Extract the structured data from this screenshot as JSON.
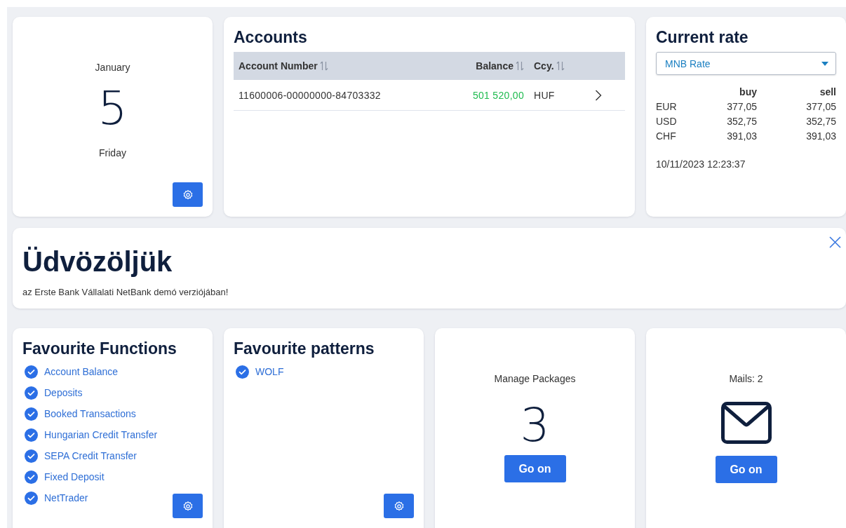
{
  "date_card": {
    "month": "January",
    "day": "5",
    "weekday": "Friday"
  },
  "accounts": {
    "title": "Accounts",
    "columns": [
      {
        "label": "Account Number"
      },
      {
        "label": "Balance"
      },
      {
        "label": "Ccy."
      }
    ],
    "rows": [
      {
        "account_number": "11600006-00000000-84703332",
        "balance": "501 520,00",
        "currency": "HUF"
      }
    ]
  },
  "current_rate": {
    "title": "Current rate",
    "source": {
      "value": "MNB Rate"
    },
    "columns": [
      "buy",
      "sell"
    ],
    "rows": [
      {
        "currency": "EUR",
        "buy": "377,05",
        "sell": "377,05"
      },
      {
        "currency": "USD",
        "buy": "352,75",
        "sell": "352,75"
      },
      {
        "currency": "CHF",
        "buy": "391,03",
        "sell": "391,03"
      }
    ],
    "timestamp": "10/11/2023 12:23:37"
  },
  "welcome": {
    "title": "Üdvözöljük",
    "message": "az Erste Bank Vállalati NetBank demó verziójában!"
  },
  "favourite_functions": {
    "title": "Favourite Functions",
    "items": [
      {
        "label": "Account Balance"
      },
      {
        "label": "Deposits"
      },
      {
        "label": "Booked Transactions"
      },
      {
        "label": "Hungarian Credit Transfer"
      },
      {
        "label": "SEPA Credit Transfer"
      },
      {
        "label": "Fixed Deposit"
      },
      {
        "label": "NetTrader"
      }
    ]
  },
  "favourite_patterns": {
    "title": "Favourite patterns",
    "items": [
      {
        "label": "WOLF"
      }
    ]
  },
  "packages": {
    "label": "Manage Packages",
    "count": "3",
    "button": "Go on"
  },
  "mails": {
    "label": "Mails: 2",
    "button": "Go on"
  }
}
